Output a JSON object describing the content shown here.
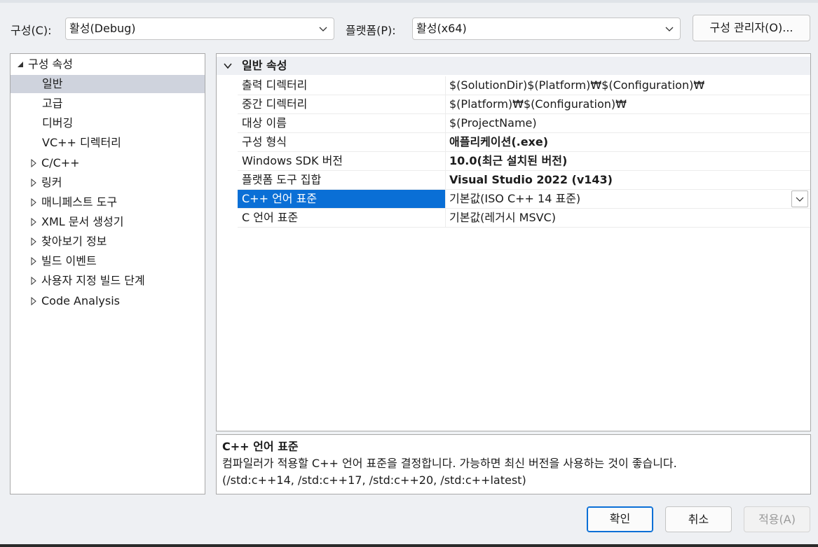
{
  "toolbar": {
    "config_label": "구성(C):",
    "config_value": "활성(Debug)",
    "platform_label": "플랫폼(P):",
    "platform_value": "활성(x64)",
    "config_manager_label": "구성 관리자(O)..."
  },
  "tree": {
    "root": "구성 속성",
    "items": [
      {
        "label": "일반",
        "selected": true,
        "expandable": false
      },
      {
        "label": "고급",
        "expandable": false
      },
      {
        "label": "디버깅",
        "expandable": false
      },
      {
        "label": "VC++ 디렉터리",
        "expandable": false
      },
      {
        "label": "C/C++",
        "expandable": true
      },
      {
        "label": "링커",
        "expandable": true
      },
      {
        "label": "매니페스트 도구",
        "expandable": true
      },
      {
        "label": "XML 문서 생성기",
        "expandable": true
      },
      {
        "label": "찾아보기 정보",
        "expandable": true
      },
      {
        "label": "빌드 이벤트",
        "expandable": true
      },
      {
        "label": "사용자 지정 빌드 단계",
        "expandable": true
      },
      {
        "label": "Code Analysis",
        "expandable": true
      }
    ]
  },
  "grid": {
    "category": "일반 속성",
    "rows": [
      {
        "name": "출력 디렉터리",
        "value": "$(SolutionDir)$(Platform)₩$(Configuration)₩",
        "bold": false
      },
      {
        "name": "중간 디렉터리",
        "value": "$(Platform)₩$(Configuration)₩",
        "bold": false
      },
      {
        "name": "대상 이름",
        "value": "$(ProjectName)",
        "bold": false
      },
      {
        "name": "구성 형식",
        "value": "애플리케이션(.exe)",
        "bold": true
      },
      {
        "name": "Windows SDK 버전",
        "value": "10.0(최근 설치된 버전)",
        "bold": true
      },
      {
        "name": "플랫폼 도구 집합",
        "value": "Visual Studio 2022 (v143)",
        "bold": true
      },
      {
        "name": "C++ 언어 표준",
        "value": "기본값(ISO C++ 14 표준)",
        "bold": false,
        "selected": true
      },
      {
        "name": "C 언어 표준",
        "value": "기본값(레거시 MSVC)",
        "bold": false
      }
    ]
  },
  "description": {
    "title": "C++ 언어 표준",
    "line1": "컴파일러가 적용할 C++ 언어 표준을 결정합니다. 가능하면 최신 버전을 사용하는 것이 좋습니다.",
    "line2": "(/std:c++14, /std:c++17, /std:c++20, /std:c++latest)"
  },
  "buttons": {
    "ok": "확인",
    "cancel": "취소",
    "apply": "적용(A)"
  },
  "colors": {
    "selection": "#0a6fd6",
    "tree_selection": "#cfd3dd",
    "disabled_text": "#9a9a9a"
  }
}
